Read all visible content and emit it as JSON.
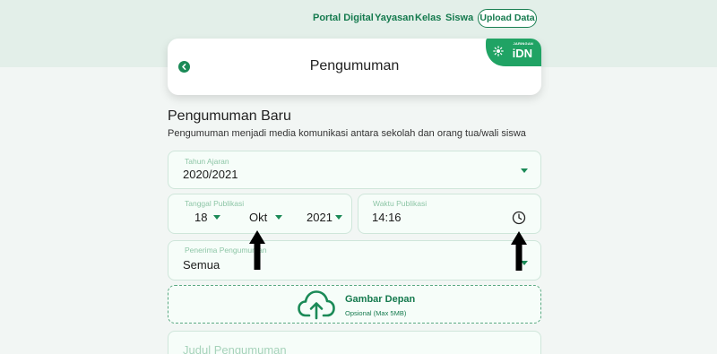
{
  "nav": {
    "links": [
      "Portal Digital",
      "Yayasan",
      "Kelas",
      "Siswa"
    ],
    "upload_label": "Upload Data"
  },
  "header": {
    "title": "Pengumuman",
    "brand_small": "JARINGAN",
    "brand_big": "iDN",
    "back_icon": "chevron-left-icon"
  },
  "section": {
    "title": "Pengumuman Baru",
    "subtitle": "Pengumuman menjadi media komunikasi antara sekolah dan orang tua/wali siswa"
  },
  "form": {
    "tahun_ajaran": {
      "label": "Tahun Ajaran",
      "value": "2020/2021"
    },
    "tanggal": {
      "label": "Tanggal Publikasi",
      "day": "18",
      "month": "Okt",
      "year": "2021"
    },
    "waktu": {
      "label": "Waktu Publikasi",
      "value": "14:16",
      "icon": "clock-icon"
    },
    "penerima": {
      "label": "Penerima Pengumuman",
      "value": "Semua"
    },
    "gambar": {
      "title": "Gambar Depan",
      "subtitle": "Opsional (Max 5MB)",
      "icon": "cloud-upload-icon"
    },
    "judul": {
      "label": "Judul Pengumuman"
    }
  },
  "colors": {
    "accent": "#1b8a57",
    "background": "#f2f6f4",
    "topband": "#e3efe9",
    "field_bg": "#f6fdf9",
    "field_border": "#cfe6da"
  }
}
